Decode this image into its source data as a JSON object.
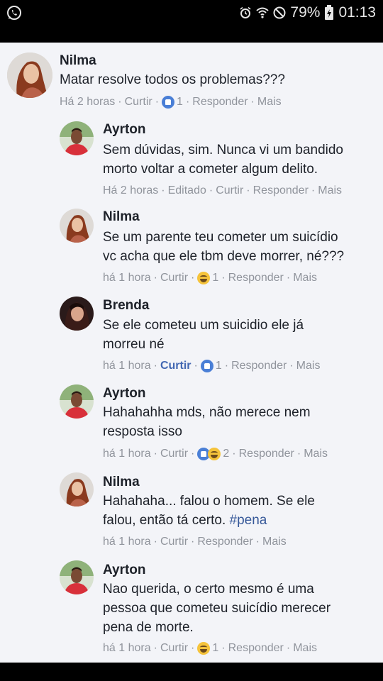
{
  "status_bar": {
    "battery": "79%",
    "time": "01:13",
    "icons": [
      "whatsapp-icon",
      "alarm-icon",
      "wifi-icon",
      "do-not-disturb-icon",
      "battery-icon"
    ]
  },
  "colors": {
    "text": "#1d2129",
    "meta": "#90949c",
    "link_active": "#4267b2",
    "hashtag": "#365899",
    "background": "#f3f4f8"
  },
  "comments": [
    {
      "author": "Nilma",
      "text_lines": [
        "Matar resolve todos os problemas???"
      ],
      "time": "Há 2 horas",
      "edited": "",
      "like_label": "Curtir",
      "reactions": [
        "like"
      ],
      "reaction_count": "1",
      "reply_label": "Responder",
      "more_label": "Mais"
    },
    {
      "author": "Ayrton",
      "text_lines": [
        "Sem dúvidas, sim. Nunca vi um bandido",
        "morto voltar a cometer algum delito."
      ],
      "time": "Há 2 horas",
      "edited": "Editado",
      "like_label": "Curtir",
      "reactions": [],
      "reaction_count": "",
      "reply_label": "Responder",
      "more_label": "Mais"
    },
    {
      "author": "Nilma",
      "text_lines": [
        "Se um parente teu cometer um suicídio",
        "vc acha que ele tbm deve morrer, né???"
      ],
      "time": "há 1 hora",
      "edited": "",
      "like_label": "Curtir",
      "reactions": [
        "haha"
      ],
      "reaction_count": "1",
      "reply_label": "Responder",
      "more_label": "Mais"
    },
    {
      "author": "Brenda",
      "text_lines": [
        "Se ele cometeu um suicidio ele já",
        "morreu né"
      ],
      "time": "há 1 hora",
      "edited": "",
      "like_label": "Curtir",
      "reactions": [
        "like"
      ],
      "reaction_count": "1",
      "reply_label": "Responder",
      "more_label": "Mais"
    },
    {
      "author": "Ayrton",
      "text_lines": [
        "Hahahahha mds, não merece nem",
        "resposta isso"
      ],
      "time": "há 1 hora",
      "edited": "",
      "like_label": "Curtir",
      "reactions": [
        "like",
        "haha"
      ],
      "reaction_count": "2",
      "reply_label": "Responder",
      "more_label": "Mais"
    },
    {
      "author": "Nilma",
      "text_lines": [
        "Hahahaha... falou o homem. Se ele",
        "falou, então tá certo. #pena"
      ],
      "time": "há 1 hora",
      "edited": "",
      "like_label": "Curtir",
      "reactions": [],
      "reaction_count": "",
      "reply_label": "Responder",
      "more_label": "Mais"
    },
    {
      "author": "Ayrton",
      "text_lines": [
        "Nao querida, o certo mesmo é uma",
        "pessoa que cometeu suicídio merecer",
        "pena de morte."
      ],
      "time": "há 1 hora",
      "edited": "",
      "like_label": "Curtir",
      "reactions": [
        "haha"
      ],
      "reaction_count": "1",
      "reply_label": "Responder",
      "more_label": "Mais"
    }
  ]
}
